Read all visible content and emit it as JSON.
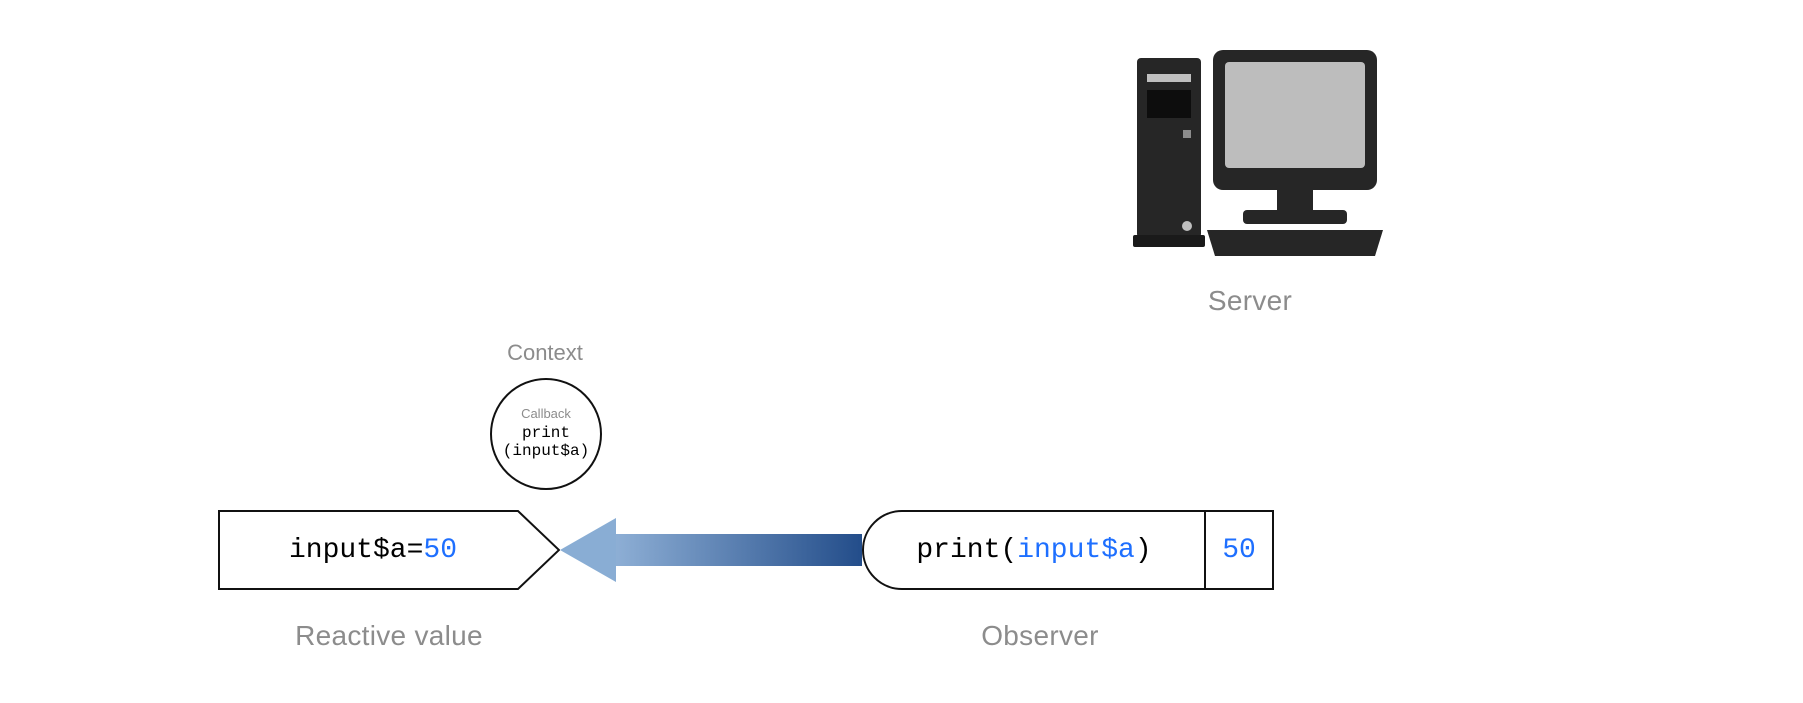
{
  "server": {
    "label": "Server"
  },
  "context": {
    "label": "Context"
  },
  "callback": {
    "label": "Callback",
    "code_line1": "print",
    "code_line2": "(input$a)"
  },
  "reactive": {
    "var": "input$a",
    "op": " = ",
    "value": "50",
    "caption": "Reactive value"
  },
  "observer": {
    "fn": "print",
    "open": "(",
    "arg": "input$a",
    "close": ")",
    "output": "50",
    "caption": "Observer"
  }
}
